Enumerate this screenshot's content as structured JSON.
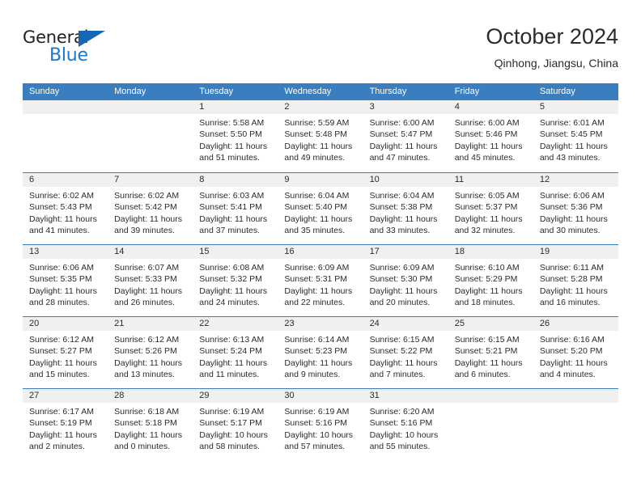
{
  "brand": {
    "name_part1": "General",
    "name_part2": "Blue",
    "triangle_color": "#1567b3",
    "blue_text_color": "#1a79c8"
  },
  "header": {
    "title": "October 2024",
    "subtitle": "Qinhong, Jiangsu, China"
  },
  "calendar": {
    "header_bg_color": "#3a7ebf",
    "daynum_bg_color": "#f0f0f0",
    "weekdays": [
      "Sunday",
      "Monday",
      "Tuesday",
      "Wednesday",
      "Thursday",
      "Friday",
      "Saturday"
    ],
    "weeks": [
      [
        {
          "day": "",
          "sunrise": "",
          "sunset": "",
          "daylight": "",
          "empty": true
        },
        {
          "day": "",
          "sunrise": "",
          "sunset": "",
          "daylight": "",
          "empty": true
        },
        {
          "day": "1",
          "sunrise": "Sunrise: 5:58 AM",
          "sunset": "Sunset: 5:50 PM",
          "daylight": "Daylight: 11 hours and 51 minutes."
        },
        {
          "day": "2",
          "sunrise": "Sunrise: 5:59 AM",
          "sunset": "Sunset: 5:48 PM",
          "daylight": "Daylight: 11 hours and 49 minutes."
        },
        {
          "day": "3",
          "sunrise": "Sunrise: 6:00 AM",
          "sunset": "Sunset: 5:47 PM",
          "daylight": "Daylight: 11 hours and 47 minutes."
        },
        {
          "day": "4",
          "sunrise": "Sunrise: 6:00 AM",
          "sunset": "Sunset: 5:46 PM",
          "daylight": "Daylight: 11 hours and 45 minutes."
        },
        {
          "day": "5",
          "sunrise": "Sunrise: 6:01 AM",
          "sunset": "Sunset: 5:45 PM",
          "daylight": "Daylight: 11 hours and 43 minutes."
        }
      ],
      [
        {
          "day": "6",
          "sunrise": "Sunrise: 6:02 AM",
          "sunset": "Sunset: 5:43 PM",
          "daylight": "Daylight: 11 hours and 41 minutes."
        },
        {
          "day": "7",
          "sunrise": "Sunrise: 6:02 AM",
          "sunset": "Sunset: 5:42 PM",
          "daylight": "Daylight: 11 hours and 39 minutes."
        },
        {
          "day": "8",
          "sunrise": "Sunrise: 6:03 AM",
          "sunset": "Sunset: 5:41 PM",
          "daylight": "Daylight: 11 hours and 37 minutes."
        },
        {
          "day": "9",
          "sunrise": "Sunrise: 6:04 AM",
          "sunset": "Sunset: 5:40 PM",
          "daylight": "Daylight: 11 hours and 35 minutes."
        },
        {
          "day": "10",
          "sunrise": "Sunrise: 6:04 AM",
          "sunset": "Sunset: 5:38 PM",
          "daylight": "Daylight: 11 hours and 33 minutes."
        },
        {
          "day": "11",
          "sunrise": "Sunrise: 6:05 AM",
          "sunset": "Sunset: 5:37 PM",
          "daylight": "Daylight: 11 hours and 32 minutes."
        },
        {
          "day": "12",
          "sunrise": "Sunrise: 6:06 AM",
          "sunset": "Sunset: 5:36 PM",
          "daylight": "Daylight: 11 hours and 30 minutes."
        }
      ],
      [
        {
          "day": "13",
          "sunrise": "Sunrise: 6:06 AM",
          "sunset": "Sunset: 5:35 PM",
          "daylight": "Daylight: 11 hours and 28 minutes."
        },
        {
          "day": "14",
          "sunrise": "Sunrise: 6:07 AM",
          "sunset": "Sunset: 5:33 PM",
          "daylight": "Daylight: 11 hours and 26 minutes."
        },
        {
          "day": "15",
          "sunrise": "Sunrise: 6:08 AM",
          "sunset": "Sunset: 5:32 PM",
          "daylight": "Daylight: 11 hours and 24 minutes."
        },
        {
          "day": "16",
          "sunrise": "Sunrise: 6:09 AM",
          "sunset": "Sunset: 5:31 PM",
          "daylight": "Daylight: 11 hours and 22 minutes."
        },
        {
          "day": "17",
          "sunrise": "Sunrise: 6:09 AM",
          "sunset": "Sunset: 5:30 PM",
          "daylight": "Daylight: 11 hours and 20 minutes."
        },
        {
          "day": "18",
          "sunrise": "Sunrise: 6:10 AM",
          "sunset": "Sunset: 5:29 PM",
          "daylight": "Daylight: 11 hours and 18 minutes."
        },
        {
          "day": "19",
          "sunrise": "Sunrise: 6:11 AM",
          "sunset": "Sunset: 5:28 PM",
          "daylight": "Daylight: 11 hours and 16 minutes."
        }
      ],
      [
        {
          "day": "20",
          "sunrise": "Sunrise: 6:12 AM",
          "sunset": "Sunset: 5:27 PM",
          "daylight": "Daylight: 11 hours and 15 minutes."
        },
        {
          "day": "21",
          "sunrise": "Sunrise: 6:12 AM",
          "sunset": "Sunset: 5:26 PM",
          "daylight": "Daylight: 11 hours and 13 minutes."
        },
        {
          "day": "22",
          "sunrise": "Sunrise: 6:13 AM",
          "sunset": "Sunset: 5:24 PM",
          "daylight": "Daylight: 11 hours and 11 minutes."
        },
        {
          "day": "23",
          "sunrise": "Sunrise: 6:14 AM",
          "sunset": "Sunset: 5:23 PM",
          "daylight": "Daylight: 11 hours and 9 minutes."
        },
        {
          "day": "24",
          "sunrise": "Sunrise: 6:15 AM",
          "sunset": "Sunset: 5:22 PM",
          "daylight": "Daylight: 11 hours and 7 minutes."
        },
        {
          "day": "25",
          "sunrise": "Sunrise: 6:15 AM",
          "sunset": "Sunset: 5:21 PM",
          "daylight": "Daylight: 11 hours and 6 minutes."
        },
        {
          "day": "26",
          "sunrise": "Sunrise: 6:16 AM",
          "sunset": "Sunset: 5:20 PM",
          "daylight": "Daylight: 11 hours and 4 minutes."
        }
      ],
      [
        {
          "day": "27",
          "sunrise": "Sunrise: 6:17 AM",
          "sunset": "Sunset: 5:19 PM",
          "daylight": "Daylight: 11 hours and 2 minutes."
        },
        {
          "day": "28",
          "sunrise": "Sunrise: 6:18 AM",
          "sunset": "Sunset: 5:18 PM",
          "daylight": "Daylight: 11 hours and 0 minutes."
        },
        {
          "day": "29",
          "sunrise": "Sunrise: 6:19 AM",
          "sunset": "Sunset: 5:17 PM",
          "daylight": "Daylight: 10 hours and 58 minutes."
        },
        {
          "day": "30",
          "sunrise": "Sunrise: 6:19 AM",
          "sunset": "Sunset: 5:16 PM",
          "daylight": "Daylight: 10 hours and 57 minutes."
        },
        {
          "day": "31",
          "sunrise": "Sunrise: 6:20 AM",
          "sunset": "Sunset: 5:16 PM",
          "daylight": "Daylight: 10 hours and 55 minutes."
        },
        {
          "day": "",
          "sunrise": "",
          "sunset": "",
          "daylight": "",
          "empty": true
        },
        {
          "day": "",
          "sunrise": "",
          "sunset": "",
          "daylight": "",
          "empty": true
        }
      ]
    ]
  }
}
